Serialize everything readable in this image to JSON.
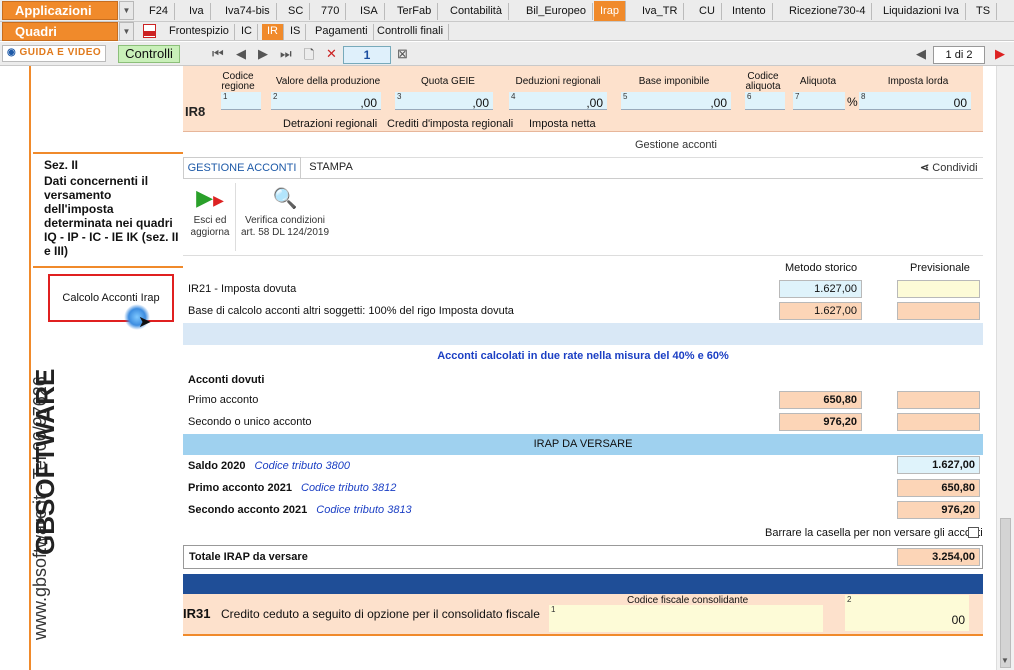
{
  "app_menu": {
    "applicazioni": "Applicazioni",
    "quadri": "Quadri"
  },
  "top_tabs": [
    "F24",
    "Iva",
    "Iva74-bis",
    "SC",
    "770",
    "ISA",
    "TerFab",
    "Contabilità",
    "Bil_Europeo",
    "Irap",
    "Iva_TR",
    "CU",
    "Intento",
    "Ricezione730-4",
    "Liquidazioni Iva",
    "TS"
  ],
  "top_tabs_active": "Irap",
  "sub_tabs": [
    "Frontespizio",
    "IC",
    "IR",
    "IS",
    "Pagamenti",
    "Controlli finali"
  ],
  "sub_tabs_active": "IR",
  "toolbar": {
    "guida": "GUIDA E VIDEO",
    "controlli": "Controlli",
    "page": "1",
    "page_count": "1 di 2"
  },
  "sidebar": {
    "vertical_text": "www.gbsoftware.it - Tel.06/97626",
    "brand": "GBSOFTWARE",
    "sez_title": "Sez. II",
    "sez_desc": "Dati concernenti il versamento dell'imposta determinata nei quadri IQ - IP - IC - IE IK (sez. II e III)",
    "calc_button": "Calcolo Acconti Irap"
  },
  "ir8": {
    "code": "IR8",
    "headers": [
      "Codice regione",
      "Valore della produzione",
      "Quota GEIE",
      "Deduzioni regionali",
      "Base imponibile",
      "Codice aliquota",
      "Aliquota",
      "Imposta lorda"
    ],
    "values": [
      "",
      ",00",
      ",00",
      ",00",
      ",00",
      "",
      "%",
      "00"
    ],
    "subtabs": [
      "Detrazioni regionali",
      "Crediti d'imposta regionali",
      "Imposta netta"
    ]
  },
  "gestione": {
    "title": "Gestione acconti",
    "tab_active": "GESTIONE ACCONTI",
    "tab_other": "STAMPA",
    "share": "Condividi",
    "btn_esci": "Esci ed aggiorna",
    "btn_verifica": "Verifica condizioni art. 58 DL 124/2019",
    "col_storico": "Metodo storico",
    "col_prev": "Previsionale",
    "ir21_label": "IR21 - Imposta dovuta",
    "ir21_storico": "1.627,00",
    "base_label": "Base di calcolo acconti altri soggetti: 100% del rigo Imposta dovuta",
    "base_storico": "1.627,00",
    "acconti_title": "Acconti calcolati in due rate nella misura del 40% e 60%",
    "acconti_dovuti": "Acconti dovuti",
    "primo_label": "Primo acconto",
    "primo_val": "650,80",
    "secondo_label": "Secondo o unico acconto",
    "secondo_val": "976,20",
    "irap_versare": "IRAP DA VERSARE",
    "saldo_label": "Saldo 2020",
    "saldo_code": "Codice tributo 3800",
    "saldo_val": "1.627,00",
    "primo2021_label": "Primo acconto 2021",
    "primo2021_code": "Codice tributo 3812",
    "primo2021_val": "650,80",
    "secondo2021_label": "Secondo acconto 2021",
    "secondo2021_code": "Codice tributo 3813",
    "secondo2021_val": "976,20",
    "barrare": "Barrare la casella per non versare gli acconti",
    "totale_label": "Totale IRAP da versare",
    "totale_val": "3.254,00"
  },
  "ir31": {
    "code": "IR31",
    "label": "Credito ceduto a seguito di opzione per il consolidato fiscale",
    "cf_header": "Codice fiscale consolidante",
    "val2": "00"
  }
}
